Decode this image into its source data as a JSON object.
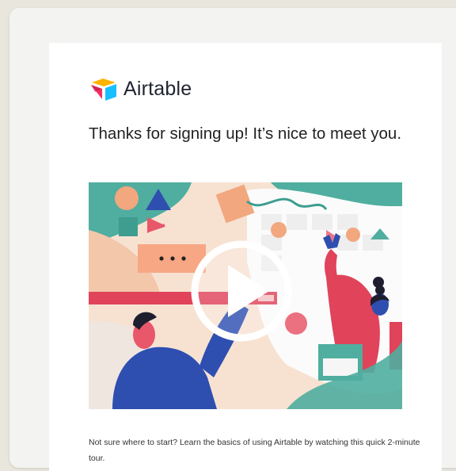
{
  "brand": {
    "name": "Airtable"
  },
  "email": {
    "headline": "Thanks for signing up! It’s nice to meet you.",
    "caption": "Not sure where to start? Learn the basics of using Airtable by watching this quick 2-minute tour."
  },
  "icons": {
    "logo": "airtable-logo-icon",
    "play": "play-icon"
  },
  "colors": {
    "logo_yellow": "#fcb400",
    "logo_blue": "#18bfff",
    "logo_red": "#f82b60",
    "teal": "#3fa89a",
    "coral": "#e8576a",
    "navy": "#2e4fb0",
    "peach": "#f2bf9a"
  }
}
